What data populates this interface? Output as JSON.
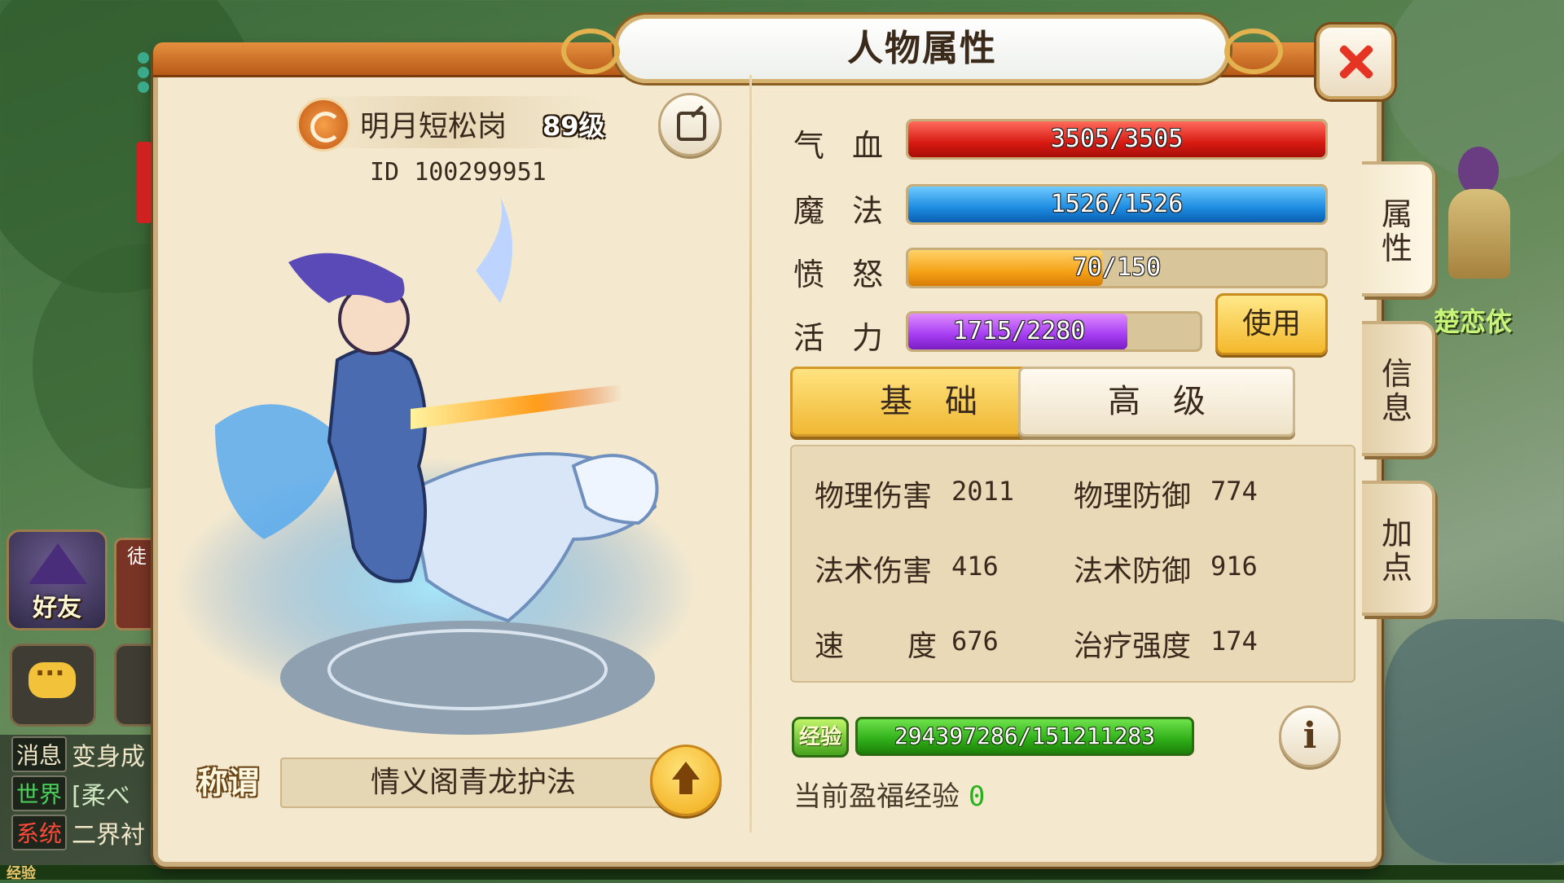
{
  "window": {
    "title": "人物属性",
    "close_icon": "close-icon"
  },
  "character": {
    "name": "明月短松岗",
    "level": "89级",
    "id_label": "ID",
    "id": "100299951",
    "school_icon": "fire-school-icon"
  },
  "vitals": [
    {
      "label": "气血",
      "value": "3505/3505",
      "fraction": 1.0,
      "color": "#d71a12"
    },
    {
      "label": "魔法",
      "value": "1526/1526",
      "fraction": 1.0,
      "color": "#1c8be0"
    },
    {
      "label": "愤怒",
      "value": "70/150",
      "fraction": 0.4667,
      "color": "#f5a216"
    },
    {
      "label": "活力",
      "value": "1715/2280",
      "fraction": 0.752,
      "color": "#a43cf2"
    }
  ],
  "use_button": "使用",
  "tabs": {
    "basic": "基础",
    "advanced": "高级"
  },
  "attributes": [
    {
      "label": "物理伤害",
      "value": "2011"
    },
    {
      "label": "物理防御",
      "value": "774"
    },
    {
      "label": "法术伤害",
      "value": "416"
    },
    {
      "label": "法术防御",
      "value": "916"
    },
    {
      "label": "速度",
      "value": "676"
    },
    {
      "label": "治疗强度",
      "value": "174"
    }
  ],
  "experience": {
    "badge": "经验",
    "value": "294397286/151211283",
    "fortune_label": "当前盈福经验",
    "fortune_value": "0"
  },
  "title_section": {
    "label": "称谓",
    "value": "情义阁青龙护法"
  },
  "side_tabs": [
    "属性",
    "信息",
    "加点"
  ],
  "background": {
    "npc_name": "楚恋依",
    "friend_button": "好友",
    "pupil_button": "徒",
    "chat_lines": [
      {
        "tag": "消息",
        "text": "变身成",
        "tag_color": "#f0e6c8",
        "text_color": "#f0e6c8"
      },
      {
        "tag": "世界",
        "text": "[柔べ",
        "tag_color": "#49d15a",
        "text_color": "#cfe8c2"
      },
      {
        "tag": "系统",
        "text": "二界衬",
        "tag_color": "#ff4a3a",
        "text_color": "#f0e6c8"
      }
    ],
    "exp_strip_label": "经验"
  }
}
